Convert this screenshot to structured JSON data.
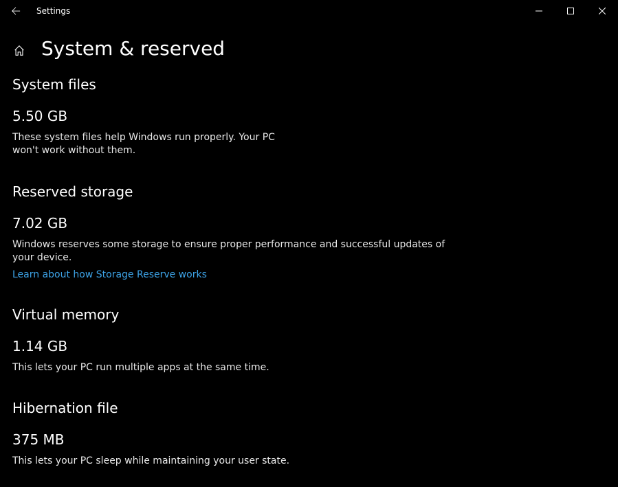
{
  "window": {
    "title": "Settings"
  },
  "header": {
    "title": "System & reserved"
  },
  "sections": {
    "system_files": {
      "heading": "System files",
      "value": "5.50 GB",
      "desc": "These system files help Windows run properly. Your PC won't work without them."
    },
    "reserved_storage": {
      "heading": "Reserved storage",
      "value": "7.02 GB",
      "desc": "Windows reserves some storage to ensure proper performance and successful updates of your device.",
      "link": "Learn about how Storage Reserve works"
    },
    "virtual_memory": {
      "heading": "Virtual memory",
      "value": "1.14 GB",
      "desc": "This lets your PC run multiple apps at the same time."
    },
    "hibernation_file": {
      "heading": "Hibernation file",
      "value": "375 MB",
      "desc": "This lets your PC sleep while maintaining your user state."
    }
  }
}
